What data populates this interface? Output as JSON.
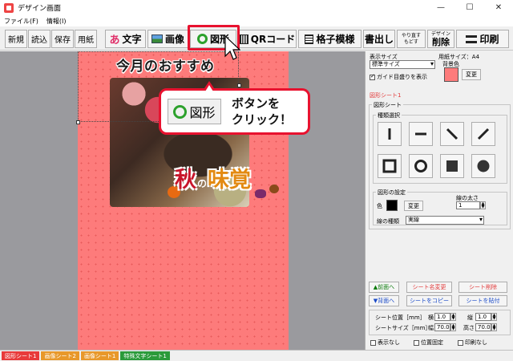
{
  "window": {
    "title": "デザイン画面",
    "minimize": "—",
    "maximize": "☐",
    "close": "✕"
  },
  "menu": {
    "file": "ファイル(F)",
    "info": "情報(I)"
  },
  "toolbar": {
    "new": "新規",
    "open": "読込",
    "save": "保存",
    "paper": "用紙",
    "text": "文字",
    "text_icon": "あ",
    "image": "画像",
    "shape": "図形",
    "qr": "QRコード",
    "pattern": "格子模様",
    "stamp": "書出し",
    "undo_top": "やり直す",
    "undo_bottom": "もどす",
    "delete_top": "デザイン",
    "delete_bottom": "削除",
    "print": "印刷"
  },
  "canvas": {
    "headline": "今月のおすすめ",
    "logo_aki": "秋",
    "logo_no": "の",
    "logo_mikaku": "味覚"
  },
  "callout": {
    "button_label": "図形",
    "text_line1": "ボタンを",
    "text_line2": "クリック！"
  },
  "panel": {
    "display_size_label": "表示サイズ",
    "display_size_value": "標準サイズ",
    "guide_label": "ガイド目盛りを表示",
    "paper_size_label": "用紙サイズ：A4",
    "bg_color_label": "背景色",
    "change": "変更",
    "sheet_name": "図形シート1",
    "shape_sheet_title": "図形シート",
    "type_select_title": "種類選択",
    "shape_settings_title": "図形の設定",
    "color_label": "色",
    "line_width_label": "線の太さ",
    "line_width_value": "1",
    "line_type_label": "線の種類",
    "line_type_value": "実線",
    "front_btn": "▲前面へ",
    "back_btn": "▼背面へ",
    "rename_btn": "シート名変更",
    "delete_btn": "シート削除",
    "copy_btn": "シートをコピー",
    "paste_btn": "シートを貼付",
    "pos_label": "シート位置［mm］",
    "size_label": "シートサイズ［mm］",
    "x_label": "横",
    "y_label": "縦",
    "w_label": "幅",
    "h_label": "高さ",
    "x_value": "1.0",
    "y_value": "1.0",
    "w_value": "70.0",
    "h_value": "70.0",
    "hide_label": "表示なし",
    "lock_label": "位置固定",
    "noprint_label": "印刷なし"
  },
  "sheets": [
    {
      "label": "図形シート1",
      "color": "#e83a3a"
    },
    {
      "label": "画像シート2",
      "color": "#e8982a"
    },
    {
      "label": "画像シート1",
      "color": "#e8982a"
    },
    {
      "label": "特殊文字シート1",
      "color": "#2a9a3a"
    }
  ]
}
